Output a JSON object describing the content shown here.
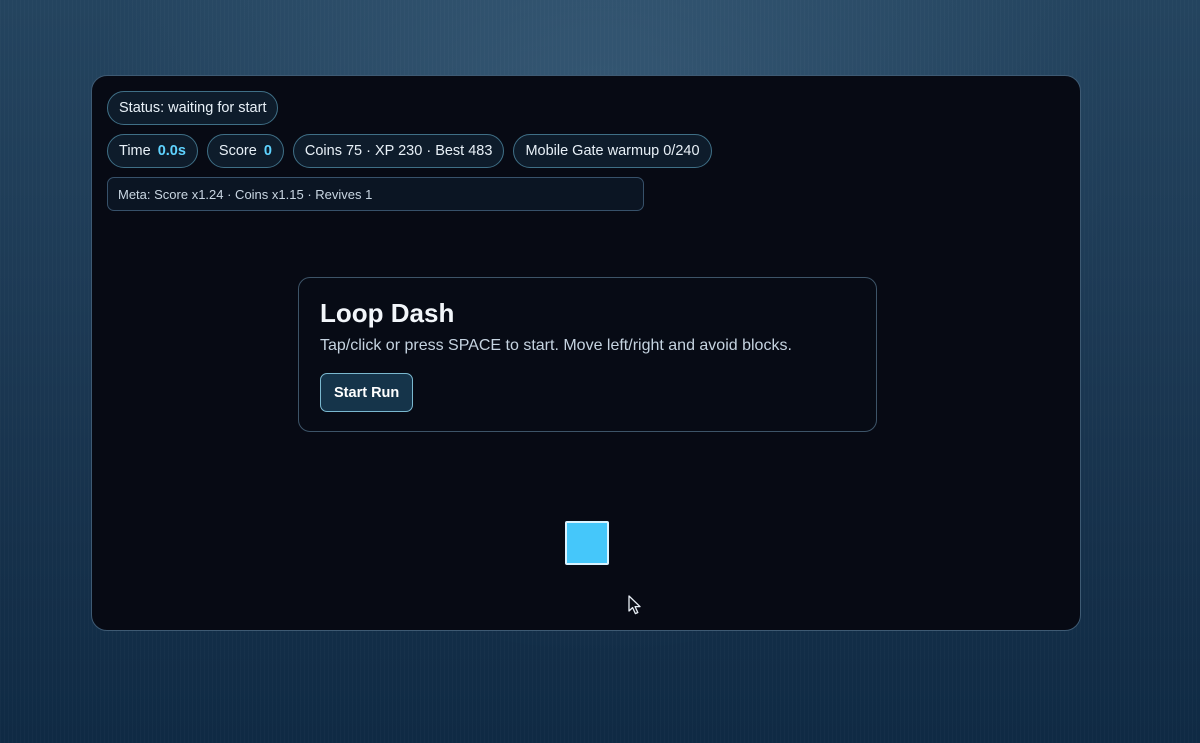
{
  "hud": {
    "status": "Status: waiting for start",
    "time_label": "Time",
    "time_value": "0.0s",
    "score_label": "Score",
    "score_value": "0",
    "progress": "Coins 75 · XP 230 · Best 483",
    "gate": "Mobile Gate warmup 0/240",
    "meta": "Meta: Score x1.24 · Coins x1.15 · Revives 1"
  },
  "overlay": {
    "title": "Loop Dash",
    "description": "Tap/click or press SPACE to start. Move left/right and avoid blocks.",
    "start_label": "Start Run"
  },
  "colors": {
    "accent": "#5fd3ff",
    "player": "#45c7fa",
    "frame_bg": "#070a14",
    "pill_border": "#3f6f86"
  },
  "icons": {
    "cursor": "mouse-pointer-icon"
  }
}
